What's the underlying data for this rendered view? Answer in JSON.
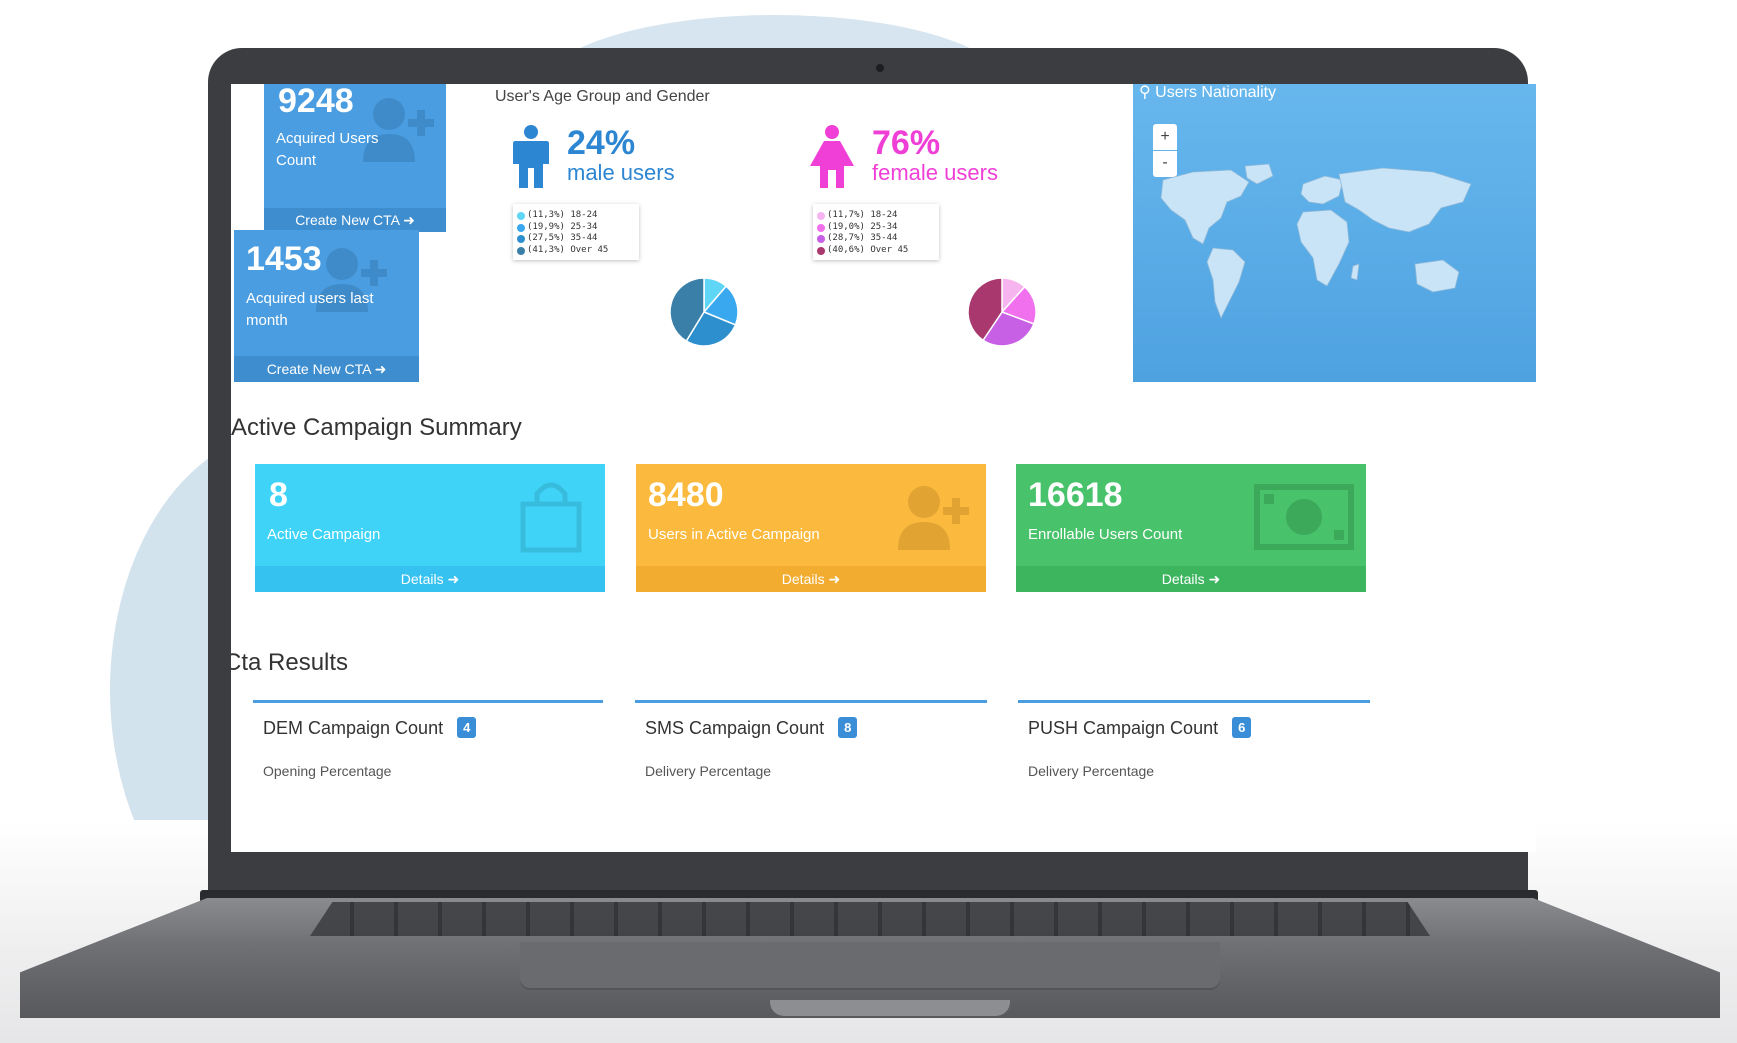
{
  "acquired": {
    "total": {
      "value": "9248",
      "label": "Acquired Users Count",
      "cta": "Create New CTA"
    },
    "last_month": {
      "value": "1453",
      "label": "Acquired users last month",
      "cta": "Create New CTA"
    }
  },
  "gender": {
    "title": "User's Age Group and Gender",
    "male": {
      "percent": "24%",
      "label": "male users",
      "legend": [
        {
          "text": "(11,3%) 18-24",
          "color": "#5fd6f5",
          "value": 11.3
        },
        {
          "text": "(19,9%) 25-34",
          "color": "#3aa8ee",
          "value": 19.9
        },
        {
          "text": "(27,5%) 35-44",
          "color": "#2e8fcf",
          "value": 27.5
        },
        {
          "text": "(41,3%) Over 45",
          "color": "#3a7fa8",
          "value": 41.3
        }
      ]
    },
    "female": {
      "percent": "76%",
      "label": "female users",
      "legend": [
        {
          "text": "(11,7%) 18-24",
          "color": "#f7b5f0",
          "value": 11.7
        },
        {
          "text": "(19,0%) 25-34",
          "color": "#f070ee",
          "value": 19.0
        },
        {
          "text": "(28,7%) 35-44",
          "color": "#c860e6",
          "value": 28.7
        },
        {
          "text": "(40,6%) Over 45",
          "color": "#a8386e",
          "value": 40.6
        }
      ]
    }
  },
  "map": {
    "title": "Users Nationality",
    "zoom_in": "+",
    "zoom_out": "-"
  },
  "campaign": {
    "title": "Active Campaign Summary",
    "tiles": [
      {
        "value": "8",
        "label": "Active Campaign",
        "link": "Details",
        "color": "#3fd3f7",
        "foot_color": "#36c2f0",
        "icon": "shopping-bag-icon"
      },
      {
        "value": "8480",
        "label": "Users in Active Campaign",
        "link": "Details",
        "color": "#fbb93d",
        "foot_color": "#f2ac30",
        "icon": "add-user-icon"
      },
      {
        "value": "16618",
        "label": "Enrollable Users Count",
        "link": "Details",
        "color": "#48c26b",
        "foot_color": "#3db55f",
        "icon": "money-icon"
      }
    ]
  },
  "cta": {
    "title": "Cta Results",
    "columns": [
      {
        "label": "DEM Campaign Count",
        "count": "4",
        "sub": "Opening Percentage"
      },
      {
        "label": "SMS Campaign Count",
        "count": "8",
        "sub": "Delivery Percentage"
      },
      {
        "label": "PUSH Campaign Count",
        "count": "6",
        "sub": "Delivery Percentage"
      }
    ]
  },
  "colors": {
    "tile_blue": "#4a9de0",
    "male": "#2d86d2",
    "female": "#ef3fd6",
    "map_sea": "#5aaee8",
    "map_land": "#c9e4f7"
  }
}
